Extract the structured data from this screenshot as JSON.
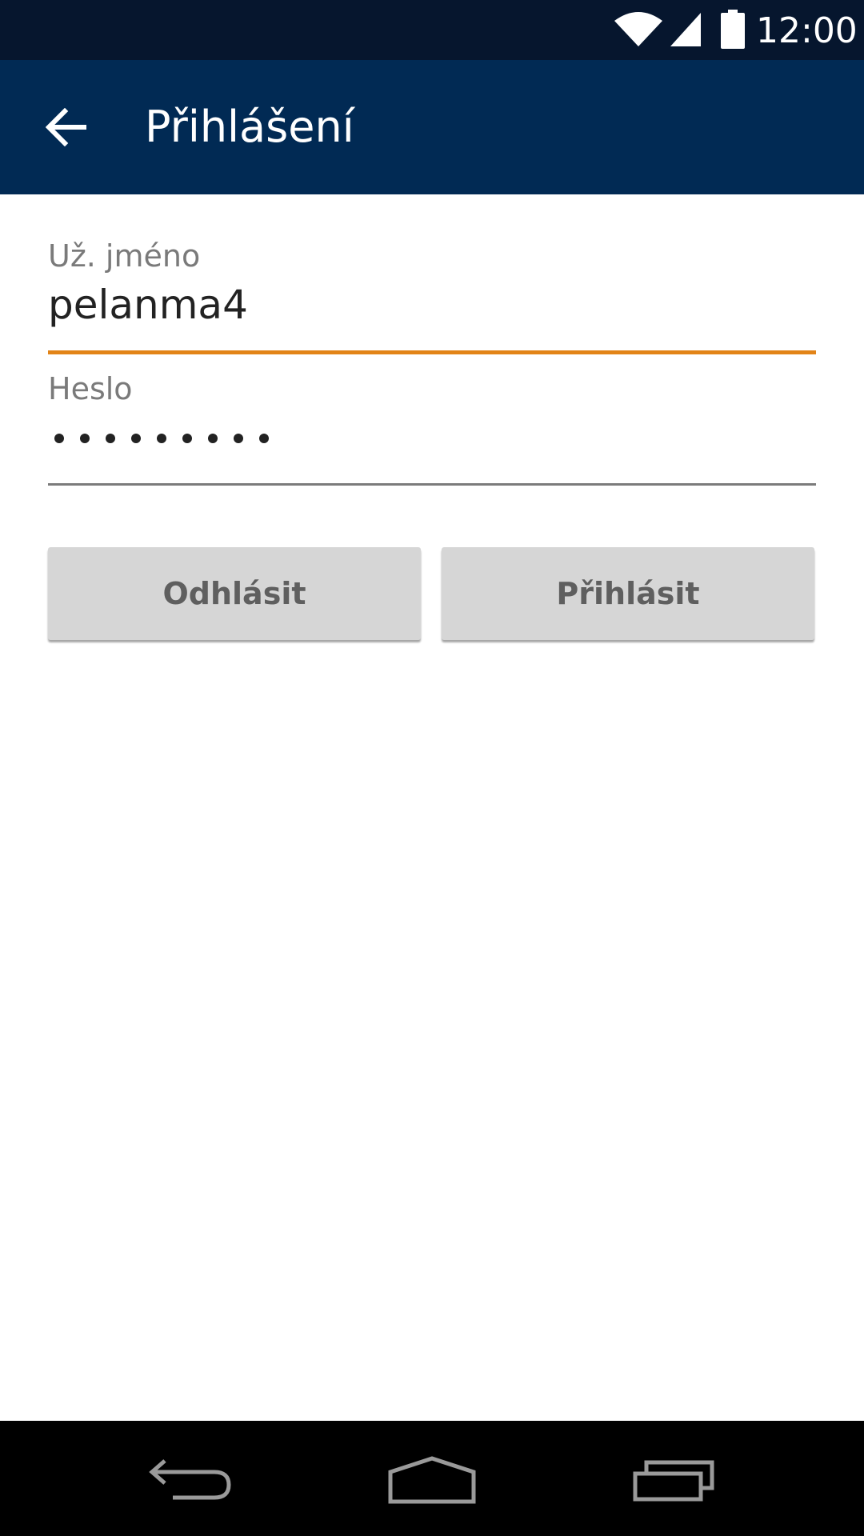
{
  "status_bar": {
    "time": "12:00",
    "icons": [
      "wifi-icon",
      "signal-icon",
      "battery-icon"
    ]
  },
  "toolbar": {
    "title": "Přihlášení",
    "back_icon": "arrow-left-icon"
  },
  "form": {
    "username": {
      "label": "Už. jméno",
      "value": "pelanma4"
    },
    "password": {
      "label": "Heslo",
      "masked_length": 9
    }
  },
  "buttons": {
    "logout_label": "Odhlásit",
    "login_label": "Přihlásit"
  },
  "nav_bar": {
    "icons": [
      "nav-back-icon",
      "nav-home-icon",
      "nav-recents-icon"
    ]
  },
  "colors": {
    "status_bar": "#06162e",
    "toolbar": "#012a54",
    "focus_underline": "#e28418",
    "button_bg": "#d6d6d6",
    "button_text": "#5f5f5f"
  }
}
